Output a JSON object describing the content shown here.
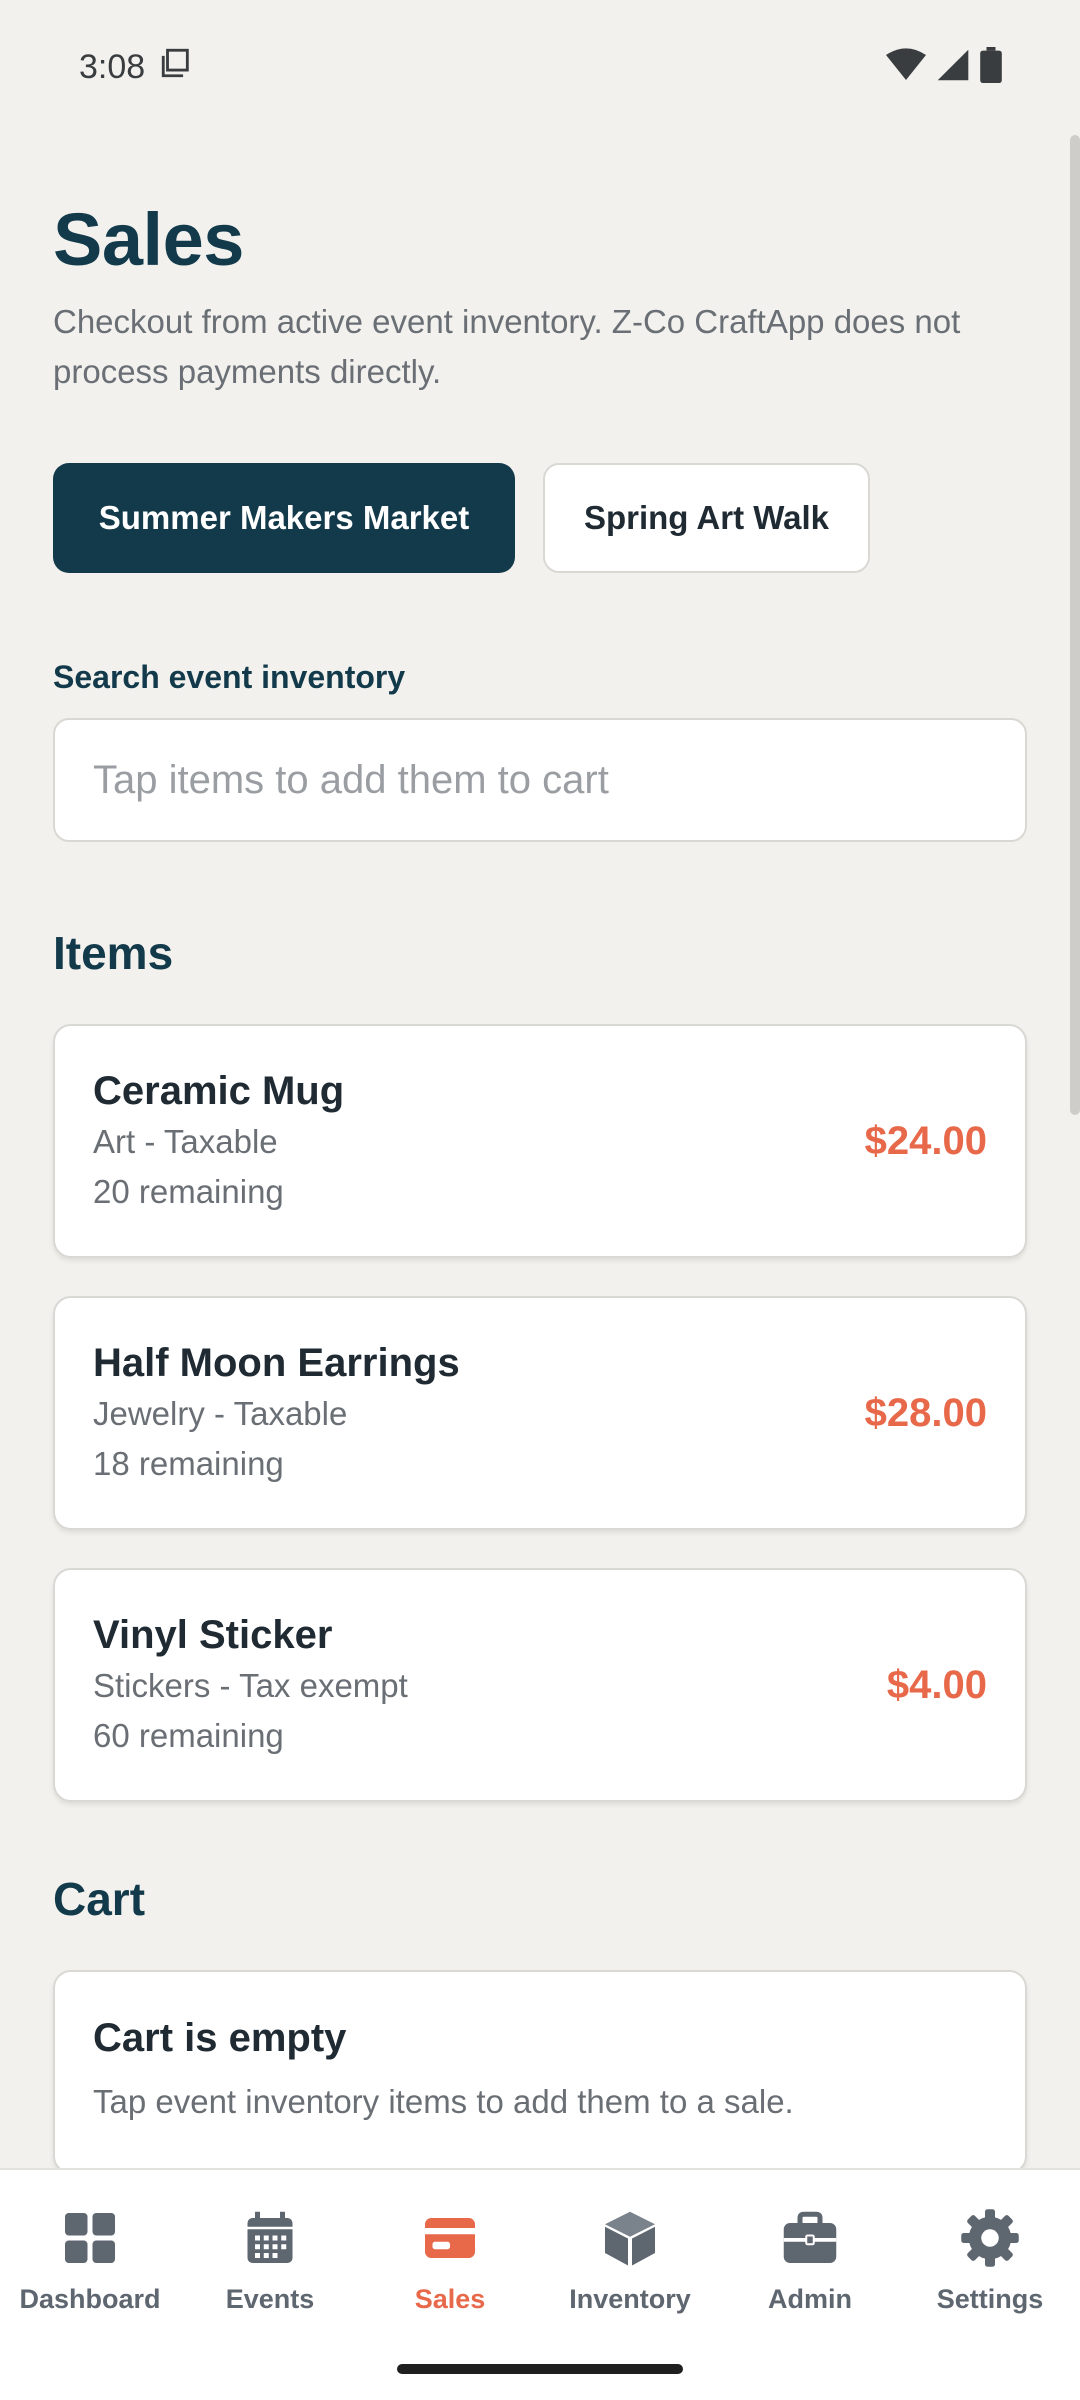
{
  "status_bar": {
    "time": "3:08"
  },
  "header": {
    "title": "Sales",
    "subtitle": "Checkout from active event inventory. Z-Co CraftApp does not process payments directly."
  },
  "event_tabs": [
    {
      "label": "Summer Makers Market",
      "active": true
    },
    {
      "label": "Spring Art Walk",
      "active": false
    }
  ],
  "search": {
    "label": "Search event inventory",
    "placeholder": "Tap items to add them to cart",
    "value": ""
  },
  "items_section": {
    "title": "Items",
    "items": [
      {
        "name": "Ceramic Mug",
        "category": "Art - Taxable",
        "remaining": "20 remaining",
        "price": "$24.00"
      },
      {
        "name": "Half Moon Earrings",
        "category": "Jewelry - Taxable",
        "remaining": "18 remaining",
        "price": "$28.00"
      },
      {
        "name": "Vinyl Sticker",
        "category": "Stickers - Tax exempt",
        "remaining": "60 remaining",
        "price": "$4.00"
      }
    ]
  },
  "cart": {
    "title": "Cart",
    "empty_title": "Cart is empty",
    "empty_text": "Tap event inventory items to add them to a sale."
  },
  "bottom_nav": [
    {
      "label": "Dashboard",
      "icon": "dashboard-icon",
      "active": false
    },
    {
      "label": "Events",
      "icon": "calendar-icon",
      "active": false
    },
    {
      "label": "Sales",
      "icon": "credit-card-icon",
      "active": true
    },
    {
      "label": "Inventory",
      "icon": "box-icon",
      "active": false
    },
    {
      "label": "Admin",
      "icon": "briefcase-icon",
      "active": false
    },
    {
      "label": "Settings",
      "icon": "gear-icon",
      "active": false
    }
  ],
  "colors": {
    "primary": "#123A4A",
    "accent": "#E8684A",
    "background": "#F2F1EE",
    "nav_inactive": "#5E6670"
  }
}
